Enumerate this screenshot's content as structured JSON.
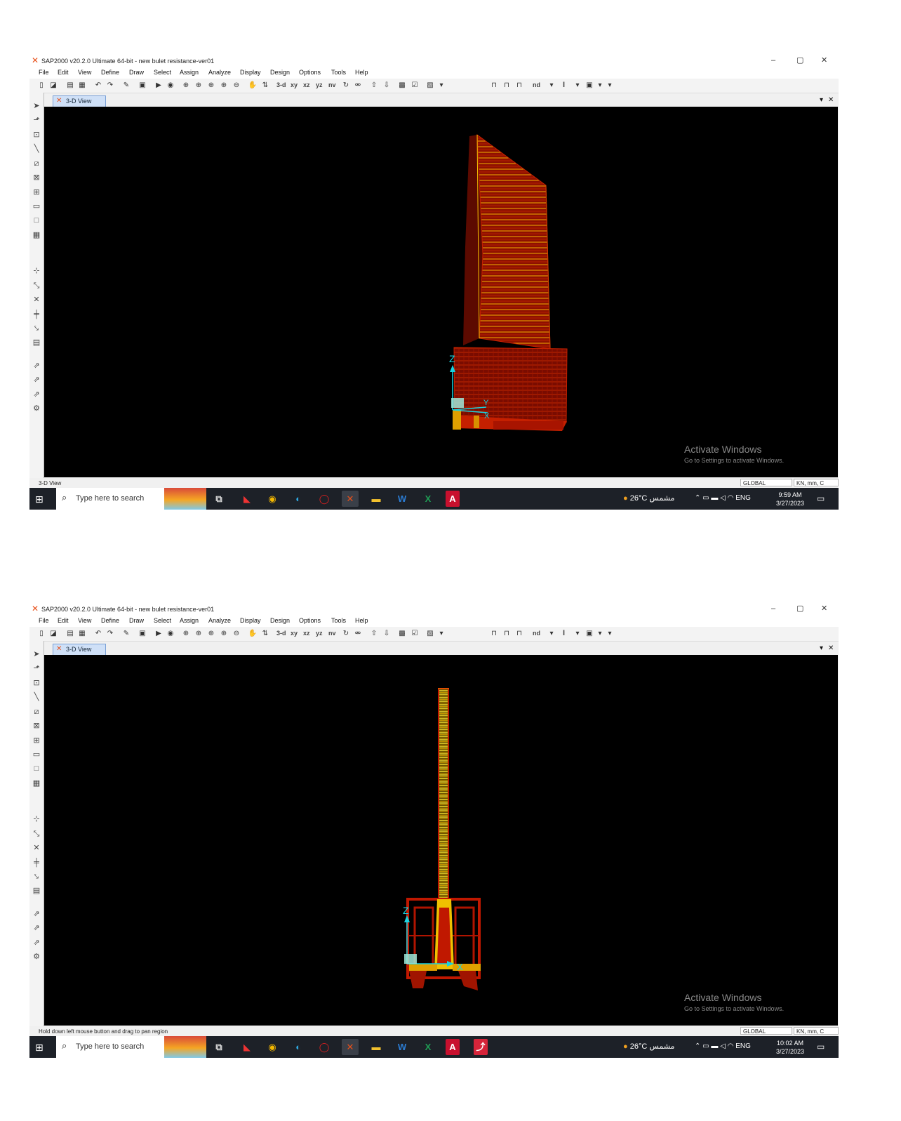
{
  "app": {
    "title": "SAP2000 v20.2.0 Ultimate 64-bit - new bulet resistance-ver01",
    "window_controls": [
      "–",
      "▢",
      "✕"
    ]
  },
  "menu": [
    "File",
    "Edit",
    "View",
    "Define",
    "Draw",
    "Select",
    "Assign",
    "Analyze",
    "Display",
    "Design",
    "Options",
    "Tools",
    "Help"
  ],
  "toolbar": {
    "view_3d": "3-d",
    "view_xy": "xy",
    "view_xz": "xz",
    "view_yz": "yz",
    "view_nv": "nv",
    "nd": "nd",
    "section": "I"
  },
  "tab": {
    "label": "3-D View"
  },
  "axes": {
    "z": "Z",
    "y": "Y",
    "x": "X"
  },
  "watermark": {
    "line1": "Activate Windows",
    "line2": "Go to Settings to activate Windows."
  },
  "status": {
    "coord_system": "GLOBAL",
    "units": "KN, mm, C",
    "screen1_text": "3-D View",
    "screen2_text": "Hold down left mouse button and drag to pan region"
  },
  "taskbar": {
    "search_placeholder": "Type here to search",
    "weather_temp": "26°C",
    "weather_desc": "مشمس",
    "language": "ENG",
    "screen1": {
      "time": "9:59 AM",
      "date": "3/27/2023"
    },
    "screen2": {
      "time": "10:02 AM",
      "date": "3/27/2023"
    }
  },
  "colors": {
    "model_red": "#c01800",
    "model_yellow": "#f0d020",
    "axis_cyan": "#19d3e0",
    "viewport_bg": "#000000"
  }
}
